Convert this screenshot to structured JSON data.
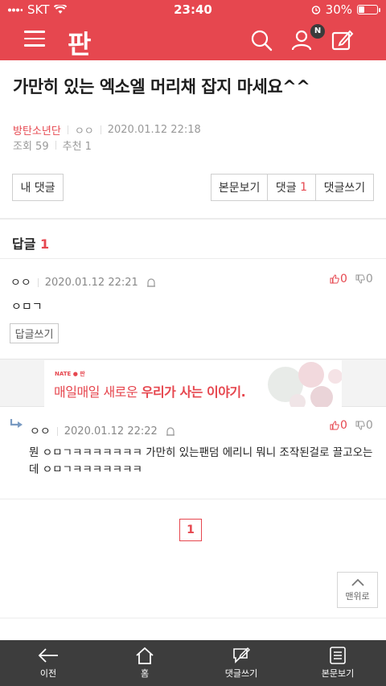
{
  "status_bar": {
    "carrier": "SKT",
    "time": "23:40",
    "battery": "30%",
    "battery_level": 0.3
  },
  "app_bar": {
    "logo": "판",
    "notification_badge": "N"
  },
  "post": {
    "title": "가만히 있는 엑소엘 머리채 잡지 마세요^^",
    "category": "방탄소년단",
    "author": "ㅇㅇ",
    "date": "2020.01.12 22:18",
    "views_label": "조회 59",
    "recommend_label": "추천 1"
  },
  "actions": {
    "my_comments": "내 댓글",
    "view_post": "본문보기",
    "comments_label": "댓글",
    "comments_count": "1",
    "write_comment": "댓글쓰기"
  },
  "replies": {
    "label": "답글",
    "count": "1"
  },
  "comments": [
    {
      "author": "ㅇㅇ",
      "date": "2020.01.12 22:21",
      "text": "ㅇㅁㄱ",
      "up": "0",
      "down": "0",
      "reply_button": "답글쓰기"
    },
    {
      "author": "ㅇㅇ",
      "date": "2020.01.12 22:22",
      "text_line1": "뭔 ㅇㅁㄱㅋㅋㅋㅋㅋㅋㅋ 가만히 있는팬덤 에리니 뭐니 조작된걸로 끌고오는",
      "text_line2": "데 ㅇㅁㄱㅋㅋㅋㅋㅋㅋㅋ",
      "up": "0",
      "down": "0"
    }
  ],
  "ad": {
    "brand": "NATE ● 판",
    "copy_plain": "매일매일 새로운",
    "copy_bold": "우리가 사는 이야기."
  },
  "pagination": {
    "current": "1"
  },
  "to_top": "맨위로",
  "bottom_nav": [
    {
      "label": "이전",
      "icon": "back-arrow-icon"
    },
    {
      "label": "홈",
      "icon": "home-icon"
    },
    {
      "label": "댓글쓰기",
      "icon": "write-comment-icon"
    },
    {
      "label": "본문보기",
      "icon": "document-icon"
    }
  ],
  "colors": {
    "brand": "#e6474f",
    "bottom_bar": "#3d3d3d"
  }
}
